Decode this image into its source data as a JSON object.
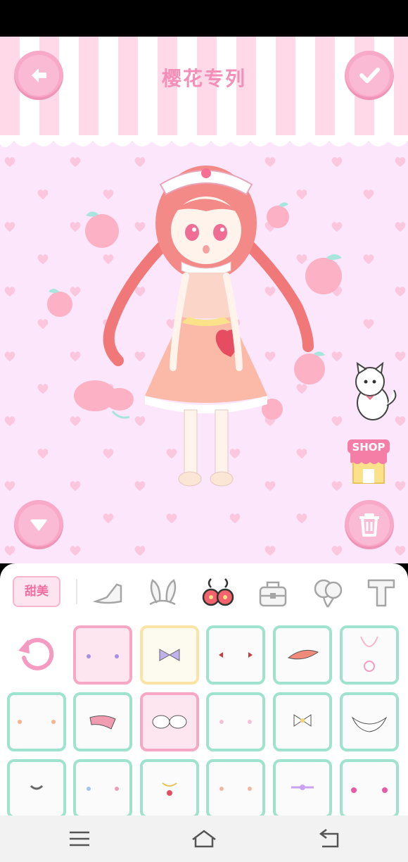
{
  "header": {
    "title": "樱花专列"
  },
  "side": {
    "shop_label": "SHOP"
  },
  "panel": {
    "active_tab_label": "甜美",
    "tabs": [
      "shoe-icon",
      "bunny-ears-icon",
      "earrings-icon",
      "bag-icon",
      "balloon-icon",
      "text-icon"
    ]
  },
  "items": {
    "row1": [
      "reset",
      "earring-purple",
      "bow-headband",
      "bow-earrings",
      "hair-clip",
      "necklace-pendant"
    ],
    "row2": [
      "earring-peach",
      "pink-scarf",
      "fur-cuffs",
      "pearl-earrings",
      "neck-bow",
      "fur-collar"
    ],
    "row3": [
      "choker",
      "blue-earrings",
      "cherry-necklace",
      "drop-earrings",
      "ribbon-choker",
      "pink-drop-earrings"
    ]
  },
  "colors": {
    "accent": "#f9a9c8",
    "title": "#f38fb8",
    "mint": "#9fe3cf",
    "selected": "#f5a7c4"
  }
}
